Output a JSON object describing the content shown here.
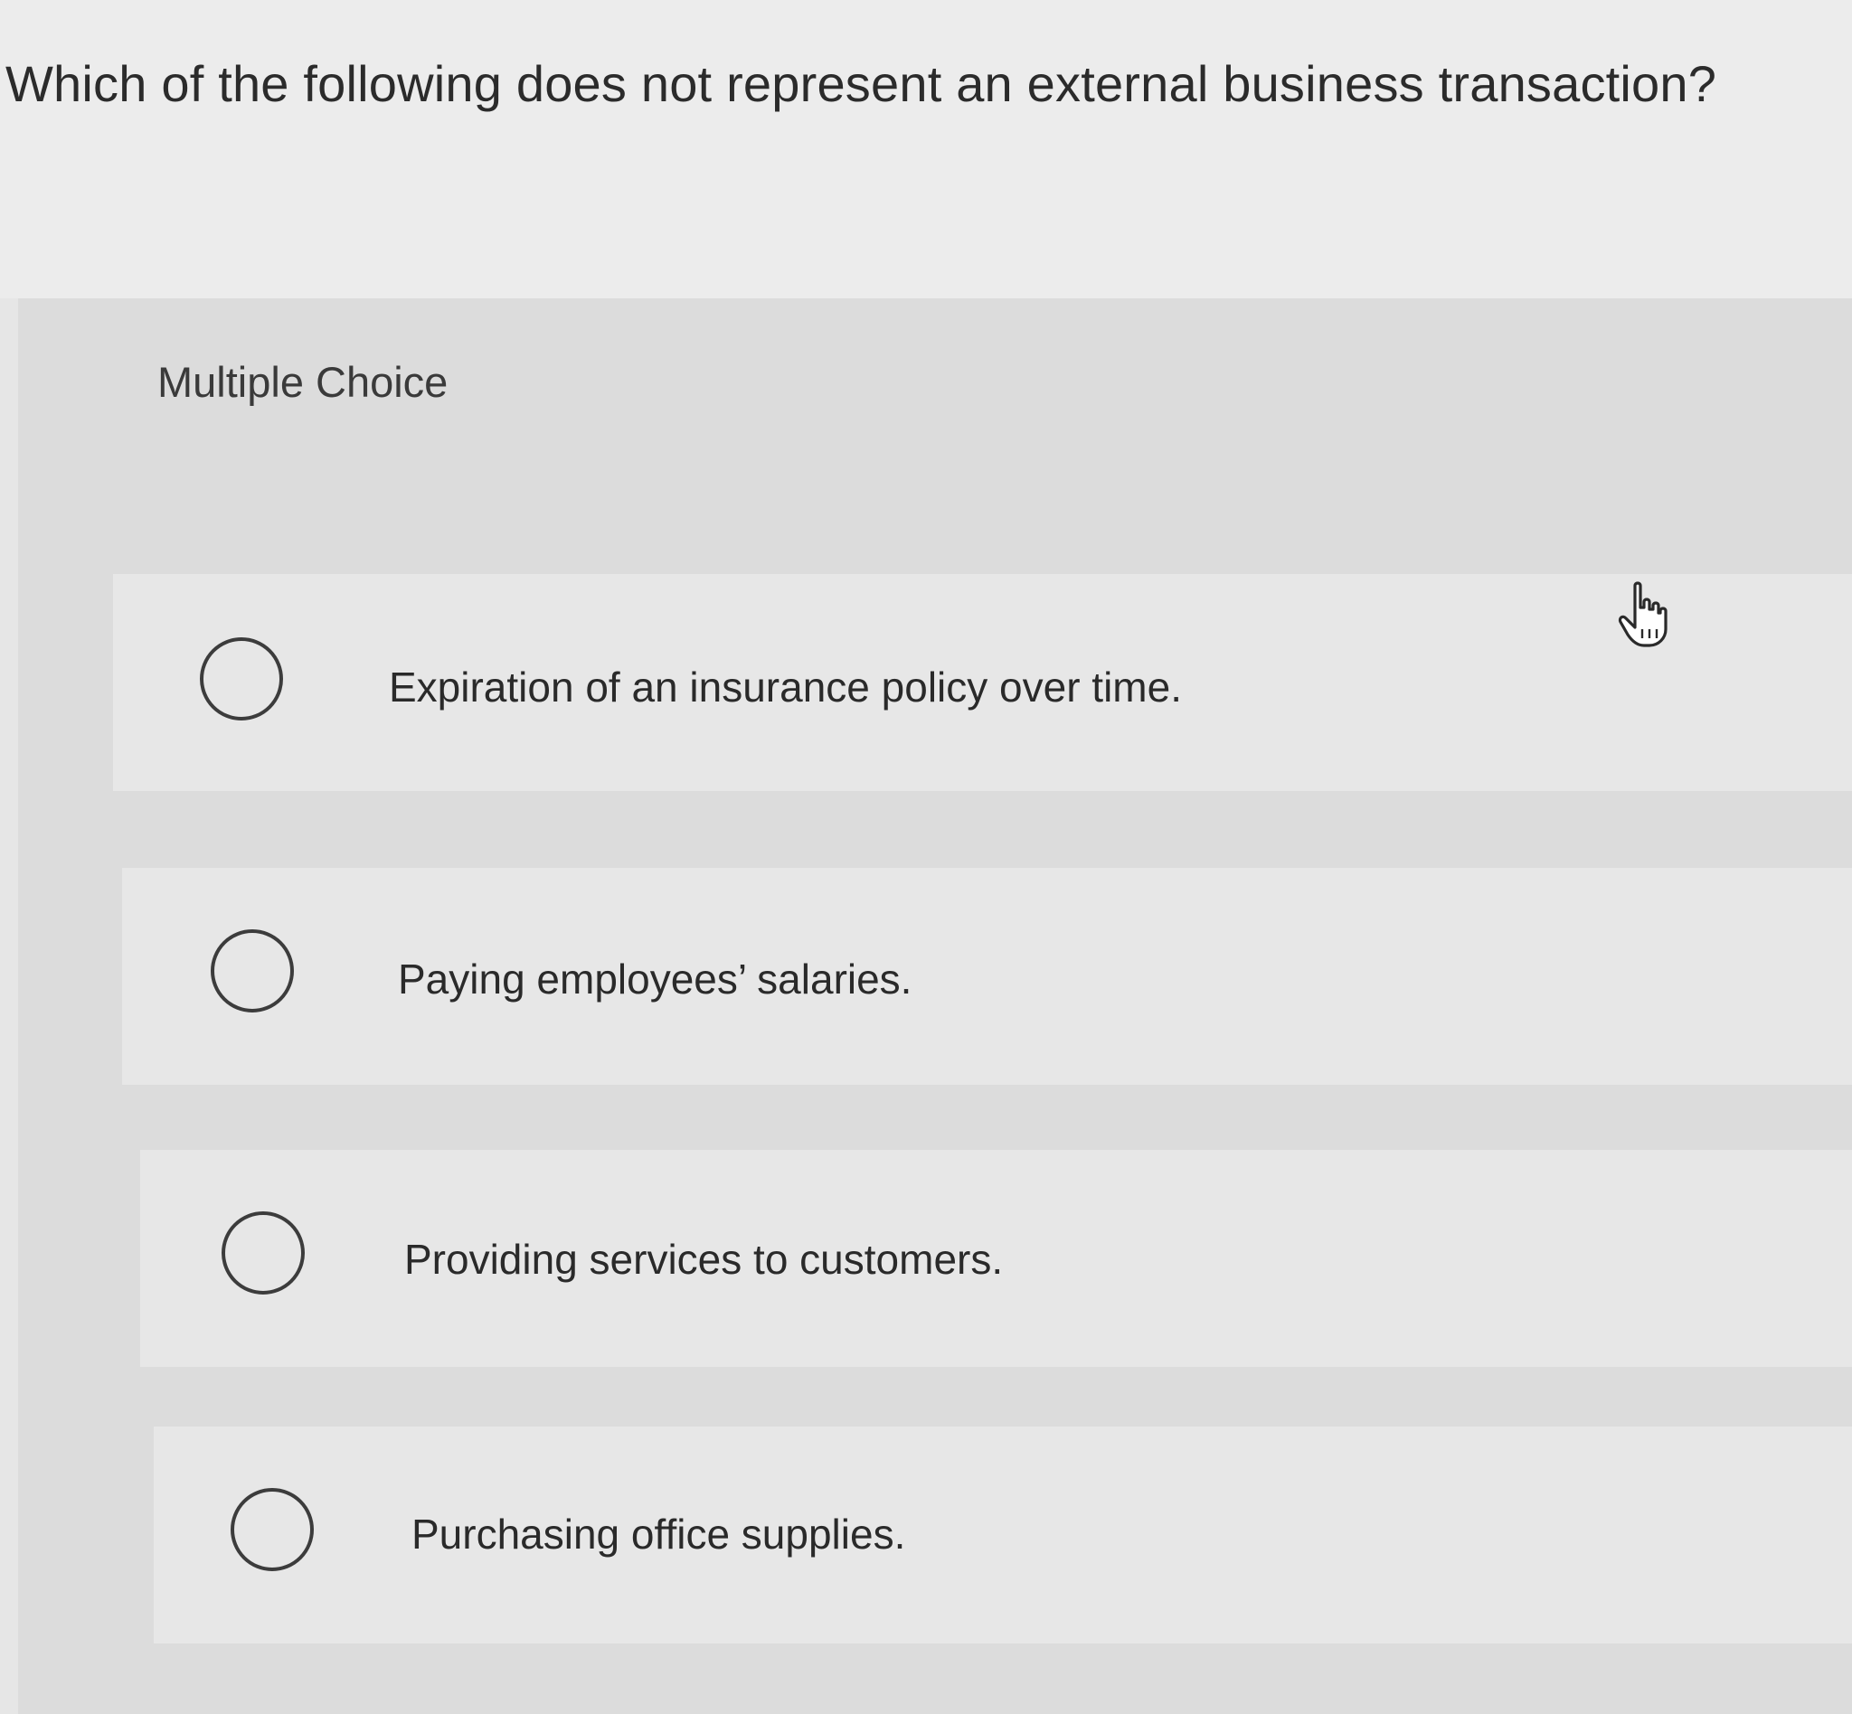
{
  "question": {
    "text": "Which of the following does not represent an external business transaction?"
  },
  "section": {
    "label": "Multiple Choice"
  },
  "choices": [
    {
      "label": "Expiration of an insurance policy over time.",
      "selected": false
    },
    {
      "label": "Paying employees’ salaries.",
      "selected": false
    },
    {
      "label": "Providing services to customers.",
      "selected": false
    },
    {
      "label": "Purchasing office supplies.",
      "selected": false
    }
  ],
  "icons": {
    "radio": "radio-unselected-icon",
    "pointer": "hand-pointer-cursor-icon"
  }
}
